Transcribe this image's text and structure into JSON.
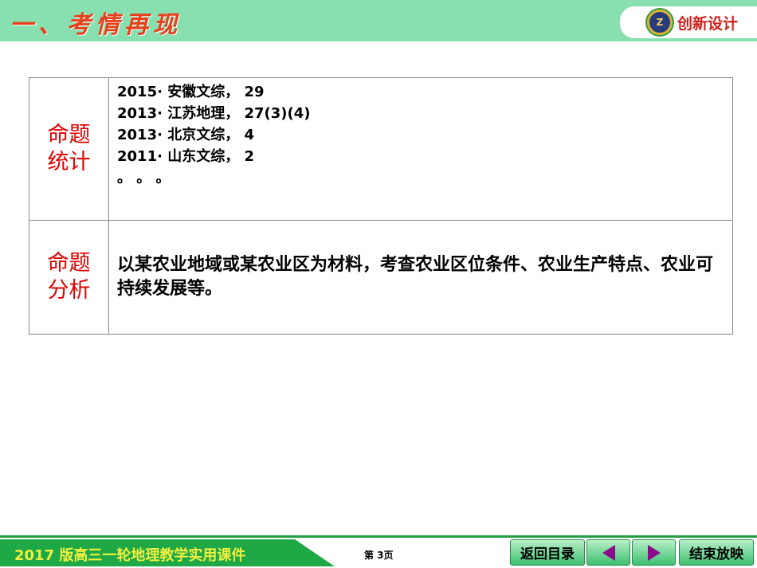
{
  "header": {
    "title": "一、考情再现",
    "logo_text": "创新设计",
    "logo_mark": "Z"
  },
  "table": {
    "row1": {
      "label_line1": "命题",
      "label_line2": "统计",
      "lines": [
        "2015· 安徽文综， 29",
        "2013· 江苏地理， 27(3)(4)",
        "2013· 北京文综， 4",
        "2011· 山东文综， 2",
        "。 。 。"
      ]
    },
    "row2": {
      "label_line1": "命题",
      "label_line2": "分析",
      "text": "以某农业地域或某农业区为材料，考查农业区位条件、农业生产特点、农业可持续发展等。"
    }
  },
  "footer": {
    "course": "2017 版高三一轮地理教学实用课件",
    "page": "第 3页",
    "back_label": "返回目录",
    "end_label": "结束放映"
  },
  "colors": {
    "header_bg": "#88e0b0",
    "footer_green": "#1ea846",
    "accent_red": "#e00000",
    "arrow": "#8a0c8a"
  }
}
